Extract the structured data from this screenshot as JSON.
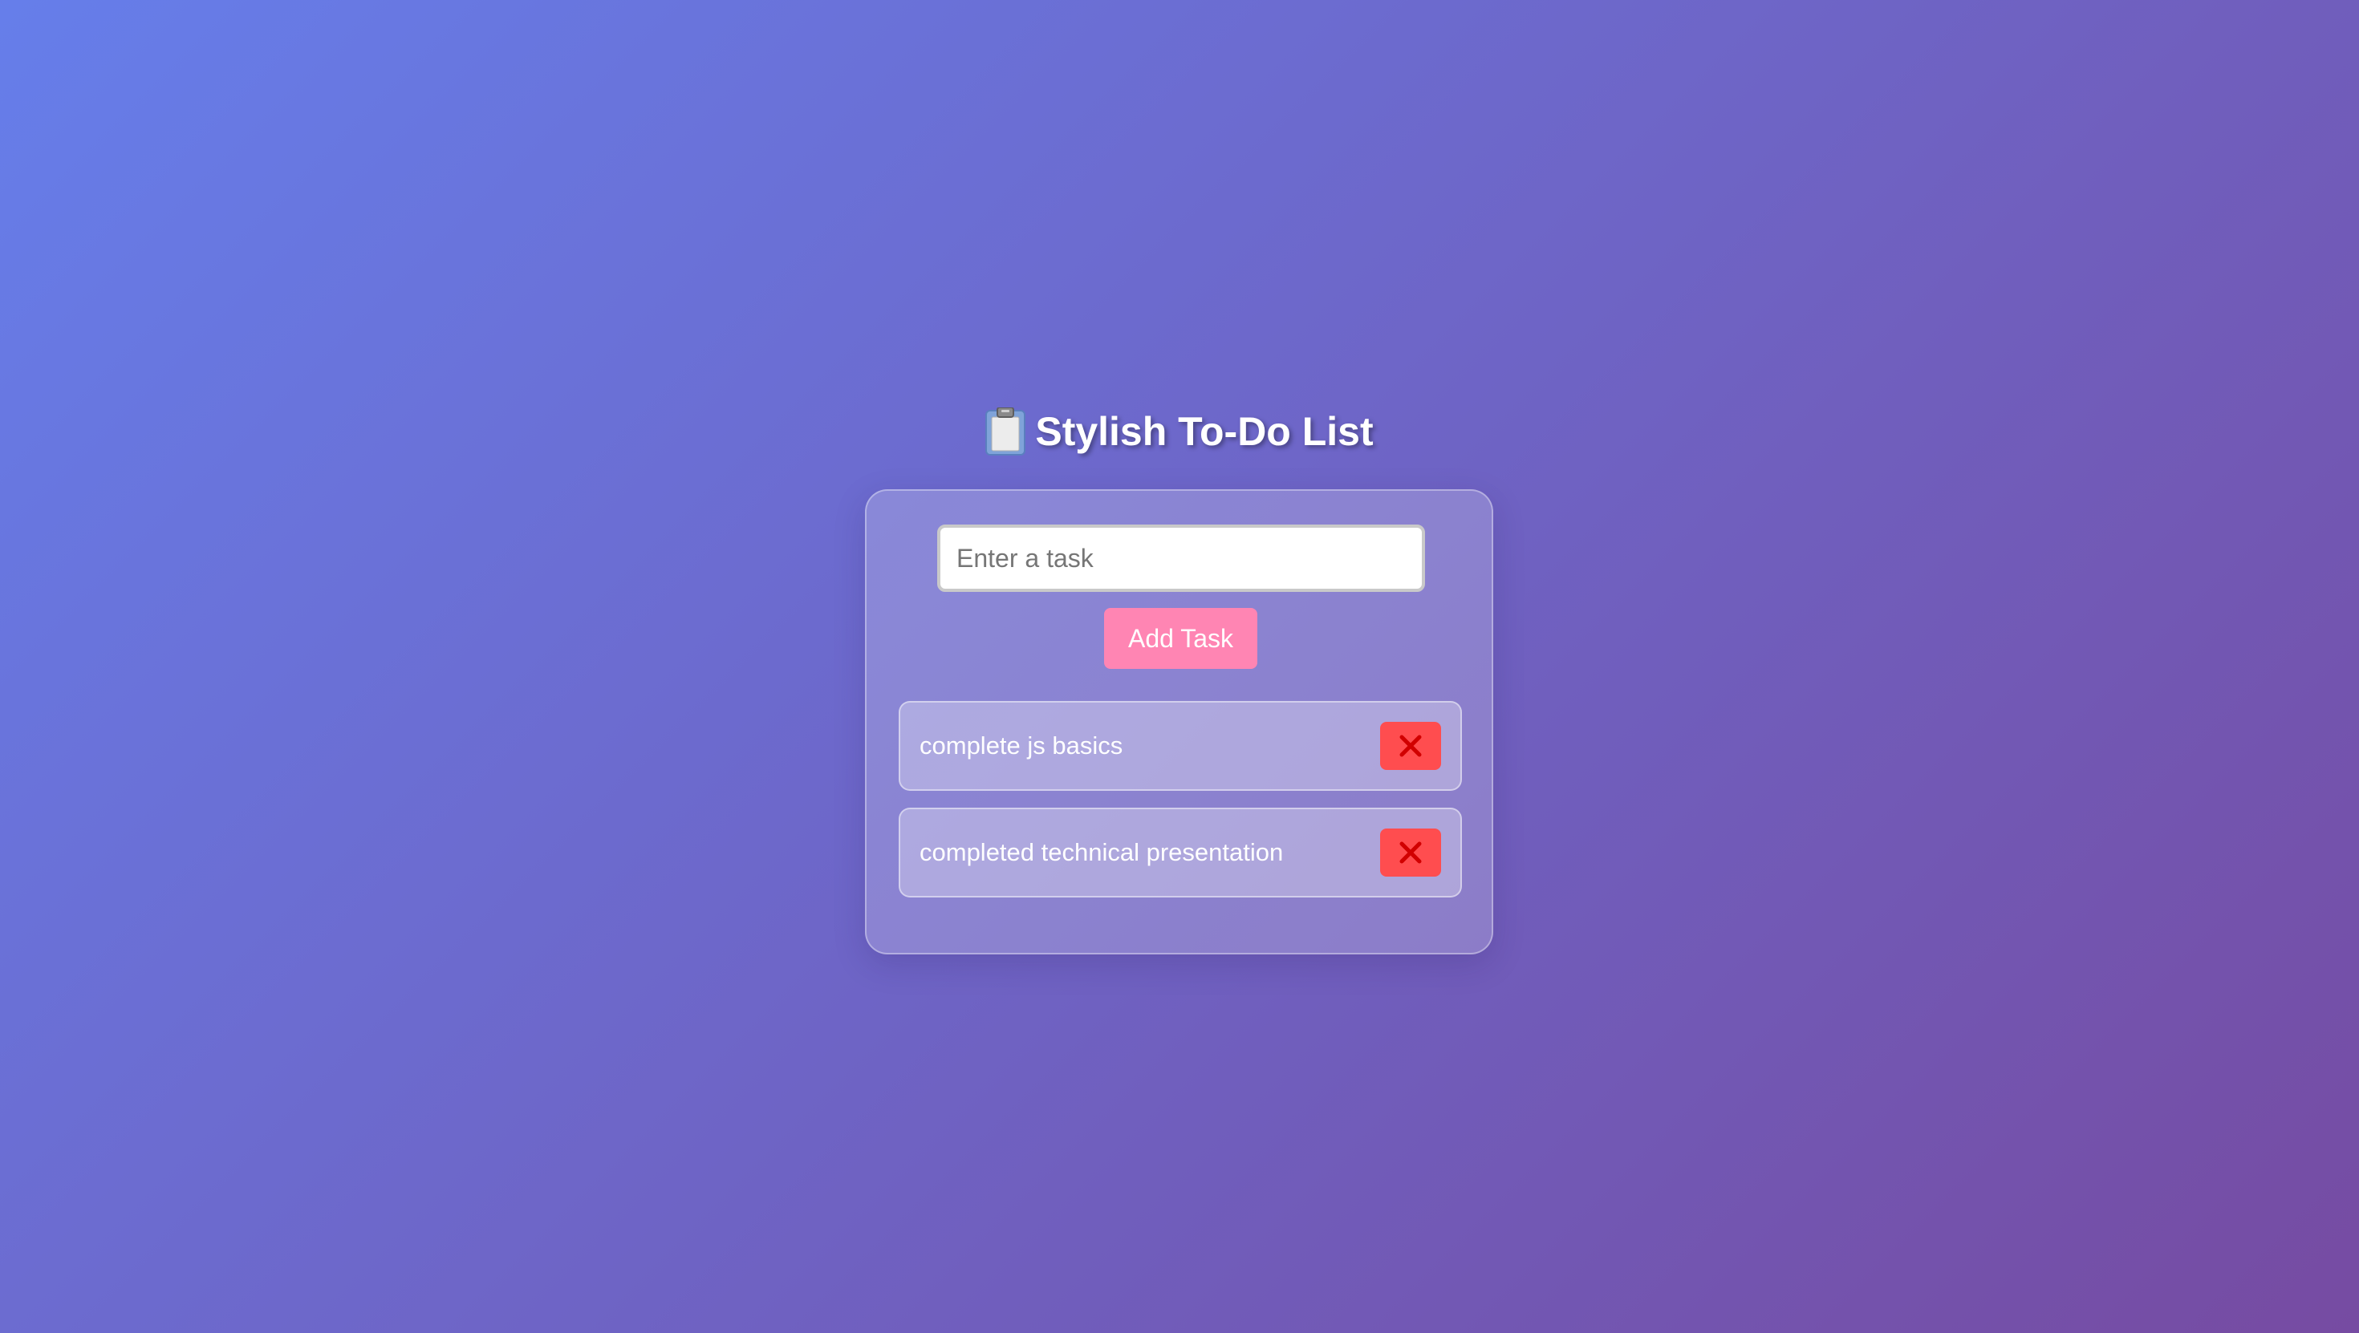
{
  "header": {
    "icon": "clipboard-icon",
    "title": "Stylish To-Do List"
  },
  "form": {
    "input_placeholder": "Enter a task",
    "input_value": "",
    "add_label": "Add Task"
  },
  "tasks": [
    {
      "text": "complete js basics",
      "delete_icon": "close-icon"
    },
    {
      "text": "completed technical presentation",
      "delete_icon": "close-icon"
    }
  ],
  "colors": {
    "background_start": "#667eea",
    "background_end": "#764ba2",
    "add_button": "#ff85b3",
    "delete_button": "#ff4d4f",
    "delete_icon": "#d10000"
  }
}
